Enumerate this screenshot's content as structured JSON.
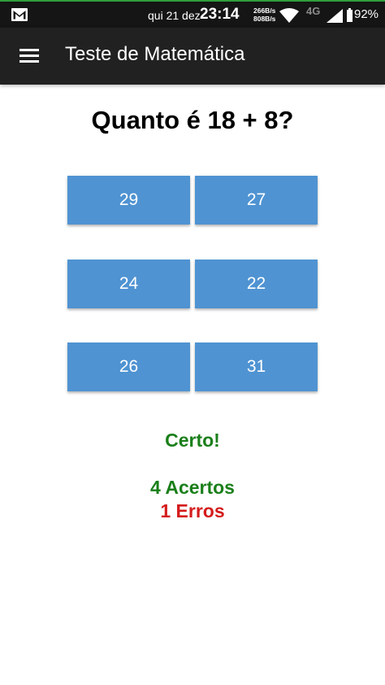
{
  "status_bar": {
    "date": "qui 21 dez",
    "time": "23:14",
    "upload_speed": "266B/s",
    "download_speed": "808B/s",
    "network_type": "4G",
    "battery_percent": "92%",
    "icons": [
      "gmail-icon",
      "wifi-icon",
      "signal-icon",
      "battery-icon"
    ]
  },
  "toolbar": {
    "title": "Teste de Matemática",
    "menu_icon": "hamburger-menu-icon"
  },
  "quiz": {
    "question": "Quanto é 18 + 8?",
    "answers": [
      "29",
      "27",
      "24",
      "22",
      "26",
      "31"
    ],
    "feedback": "Certo!",
    "correct_count": "4 Acertos",
    "wrong_count": "1 Erros"
  },
  "colors": {
    "status_bar_bg": "#151515",
    "toolbar_bg": "#212121",
    "button_bg": "#4f93d2",
    "correct": "#1a7f1a",
    "wrong": "#d41c1c",
    "accent_line": "#2e9e3c"
  }
}
